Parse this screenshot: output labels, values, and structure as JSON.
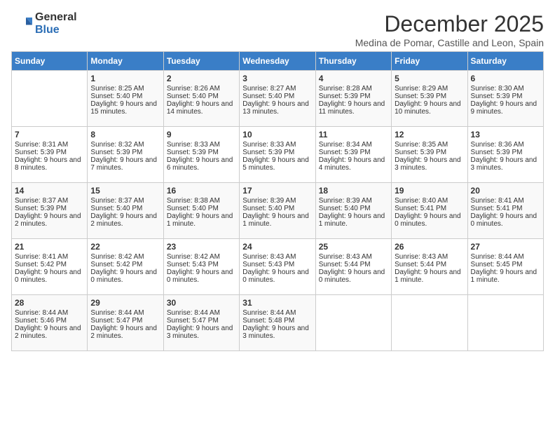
{
  "header": {
    "logo_general": "General",
    "logo_blue": "Blue",
    "month_title": "December 2025",
    "location": "Medina de Pomar, Castille and Leon, Spain"
  },
  "weekdays": [
    "Sunday",
    "Monday",
    "Tuesday",
    "Wednesday",
    "Thursday",
    "Friday",
    "Saturday"
  ],
  "weeks": [
    [
      {
        "day": "",
        "sunrise": "",
        "sunset": "",
        "daylight": ""
      },
      {
        "day": "1",
        "sunrise": "Sunrise: 8:25 AM",
        "sunset": "Sunset: 5:40 PM",
        "daylight": "Daylight: 9 hours and 15 minutes."
      },
      {
        "day": "2",
        "sunrise": "Sunrise: 8:26 AM",
        "sunset": "Sunset: 5:40 PM",
        "daylight": "Daylight: 9 hours and 14 minutes."
      },
      {
        "day": "3",
        "sunrise": "Sunrise: 8:27 AM",
        "sunset": "Sunset: 5:40 PM",
        "daylight": "Daylight: 9 hours and 13 minutes."
      },
      {
        "day": "4",
        "sunrise": "Sunrise: 8:28 AM",
        "sunset": "Sunset: 5:39 PM",
        "daylight": "Daylight: 9 hours and 11 minutes."
      },
      {
        "day": "5",
        "sunrise": "Sunrise: 8:29 AM",
        "sunset": "Sunset: 5:39 PM",
        "daylight": "Daylight: 9 hours and 10 minutes."
      },
      {
        "day": "6",
        "sunrise": "Sunrise: 8:30 AM",
        "sunset": "Sunset: 5:39 PM",
        "daylight": "Daylight: 9 hours and 9 minutes."
      }
    ],
    [
      {
        "day": "7",
        "sunrise": "Sunrise: 8:31 AM",
        "sunset": "Sunset: 5:39 PM",
        "daylight": "Daylight: 9 hours and 8 minutes."
      },
      {
        "day": "8",
        "sunrise": "Sunrise: 8:32 AM",
        "sunset": "Sunset: 5:39 PM",
        "daylight": "Daylight: 9 hours and 7 minutes."
      },
      {
        "day": "9",
        "sunrise": "Sunrise: 8:33 AM",
        "sunset": "Sunset: 5:39 PM",
        "daylight": "Daylight: 9 hours and 6 minutes."
      },
      {
        "day": "10",
        "sunrise": "Sunrise: 8:33 AM",
        "sunset": "Sunset: 5:39 PM",
        "daylight": "Daylight: 9 hours and 5 minutes."
      },
      {
        "day": "11",
        "sunrise": "Sunrise: 8:34 AM",
        "sunset": "Sunset: 5:39 PM",
        "daylight": "Daylight: 9 hours and 4 minutes."
      },
      {
        "day": "12",
        "sunrise": "Sunrise: 8:35 AM",
        "sunset": "Sunset: 5:39 PM",
        "daylight": "Daylight: 9 hours and 3 minutes."
      },
      {
        "day": "13",
        "sunrise": "Sunrise: 8:36 AM",
        "sunset": "Sunset: 5:39 PM",
        "daylight": "Daylight: 9 hours and 3 minutes."
      }
    ],
    [
      {
        "day": "14",
        "sunrise": "Sunrise: 8:37 AM",
        "sunset": "Sunset: 5:39 PM",
        "daylight": "Daylight: 9 hours and 2 minutes."
      },
      {
        "day": "15",
        "sunrise": "Sunrise: 8:37 AM",
        "sunset": "Sunset: 5:40 PM",
        "daylight": "Daylight: 9 hours and 2 minutes."
      },
      {
        "day": "16",
        "sunrise": "Sunrise: 8:38 AM",
        "sunset": "Sunset: 5:40 PM",
        "daylight": "Daylight: 9 hours and 1 minute."
      },
      {
        "day": "17",
        "sunrise": "Sunrise: 8:39 AM",
        "sunset": "Sunset: 5:40 PM",
        "daylight": "Daylight: 9 hours and 1 minute."
      },
      {
        "day": "18",
        "sunrise": "Sunrise: 8:39 AM",
        "sunset": "Sunset: 5:40 PM",
        "daylight": "Daylight: 9 hours and 1 minute."
      },
      {
        "day": "19",
        "sunrise": "Sunrise: 8:40 AM",
        "sunset": "Sunset: 5:41 PM",
        "daylight": "Daylight: 9 hours and 0 minutes."
      },
      {
        "day": "20",
        "sunrise": "Sunrise: 8:41 AM",
        "sunset": "Sunset: 5:41 PM",
        "daylight": "Daylight: 9 hours and 0 minutes."
      }
    ],
    [
      {
        "day": "21",
        "sunrise": "Sunrise: 8:41 AM",
        "sunset": "Sunset: 5:42 PM",
        "daylight": "Daylight: 9 hours and 0 minutes."
      },
      {
        "day": "22",
        "sunrise": "Sunrise: 8:42 AM",
        "sunset": "Sunset: 5:42 PM",
        "daylight": "Daylight: 9 hours and 0 minutes."
      },
      {
        "day": "23",
        "sunrise": "Sunrise: 8:42 AM",
        "sunset": "Sunset: 5:43 PM",
        "daylight": "Daylight: 9 hours and 0 minutes."
      },
      {
        "day": "24",
        "sunrise": "Sunrise: 8:43 AM",
        "sunset": "Sunset: 5:43 PM",
        "daylight": "Daylight: 9 hours and 0 minutes."
      },
      {
        "day": "25",
        "sunrise": "Sunrise: 8:43 AM",
        "sunset": "Sunset: 5:44 PM",
        "daylight": "Daylight: 9 hours and 0 minutes."
      },
      {
        "day": "26",
        "sunrise": "Sunrise: 8:43 AM",
        "sunset": "Sunset: 5:44 PM",
        "daylight": "Daylight: 9 hours and 1 minute."
      },
      {
        "day": "27",
        "sunrise": "Sunrise: 8:44 AM",
        "sunset": "Sunset: 5:45 PM",
        "daylight": "Daylight: 9 hours and 1 minute."
      }
    ],
    [
      {
        "day": "28",
        "sunrise": "Sunrise: 8:44 AM",
        "sunset": "Sunset: 5:46 PM",
        "daylight": "Daylight: 9 hours and 2 minutes."
      },
      {
        "day": "29",
        "sunrise": "Sunrise: 8:44 AM",
        "sunset": "Sunset: 5:47 PM",
        "daylight": "Daylight: 9 hours and 2 minutes."
      },
      {
        "day": "30",
        "sunrise": "Sunrise: 8:44 AM",
        "sunset": "Sunset: 5:47 PM",
        "daylight": "Daylight: 9 hours and 3 minutes."
      },
      {
        "day": "31",
        "sunrise": "Sunrise: 8:44 AM",
        "sunset": "Sunset: 5:48 PM",
        "daylight": "Daylight: 9 hours and 3 minutes."
      },
      {
        "day": "",
        "sunrise": "",
        "sunset": "",
        "daylight": ""
      },
      {
        "day": "",
        "sunrise": "",
        "sunset": "",
        "daylight": ""
      },
      {
        "day": "",
        "sunrise": "",
        "sunset": "",
        "daylight": ""
      }
    ]
  ]
}
